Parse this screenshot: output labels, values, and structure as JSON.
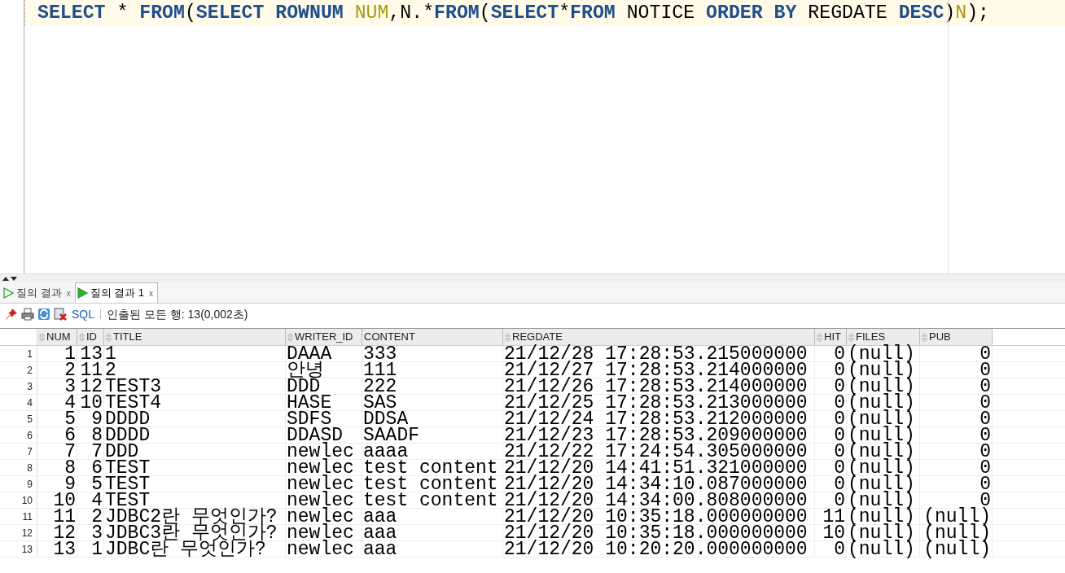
{
  "editor": {
    "tokens": [
      {
        "text": "SELECT",
        "kind": "keyword"
      },
      {
        "text": " * ",
        "kind": "plain"
      },
      {
        "text": "FROM",
        "kind": "keyword"
      },
      {
        "text": "(",
        "kind": "plain"
      },
      {
        "text": "SELECT ROWNUM ",
        "kind": "keyword"
      },
      {
        "text": "NUM",
        "kind": "alias"
      },
      {
        "text": ",N.*",
        "kind": "plain"
      },
      {
        "text": "FROM",
        "kind": "keyword"
      },
      {
        "text": "(",
        "kind": "plain"
      },
      {
        "text": "SELECT",
        "kind": "keyword"
      },
      {
        "text": "*",
        "kind": "plain"
      },
      {
        "text": "FROM",
        "kind": "keyword"
      },
      {
        "text": " NOTICE ",
        "kind": "plain"
      },
      {
        "text": "ORDER BY",
        "kind": "keyword"
      },
      {
        "text": " REGDATE ",
        "kind": "plain"
      },
      {
        "text": "DESC",
        "kind": "keyword"
      },
      {
        "text": ")",
        "kind": "plain"
      },
      {
        "text": "N",
        "kind": "alias"
      },
      {
        "text": ");",
        "kind": "plain"
      }
    ]
  },
  "result_tabs": [
    {
      "label": "질의 결과",
      "close": "x",
      "selected": false
    },
    {
      "label": "질의 결과 1",
      "close": "x",
      "selected": true
    }
  ],
  "toolbar": {
    "sql_link": "SQL",
    "status": "인출된 모든 행: 13(0,002초)"
  },
  "table": {
    "columns": [
      {
        "name": "NUM",
        "kind": "number",
        "sortable": true
      },
      {
        "name": "ID",
        "kind": "number",
        "sortable": true
      },
      {
        "name": "TITLE",
        "kind": "text",
        "sortable": true
      },
      {
        "name": "WRITER_ID",
        "kind": "text",
        "sortable": true
      },
      {
        "name": "CONTENT",
        "kind": "text",
        "sortable": false
      },
      {
        "name": "REGDATE",
        "kind": "text",
        "sortable": true
      },
      {
        "name": "HIT",
        "kind": "number",
        "sortable": true
      },
      {
        "name": "FILES",
        "kind": "text",
        "sortable": true
      },
      {
        "name": "PUB",
        "kind": "number",
        "sortable": true
      }
    ],
    "rows": [
      {
        "number": "1",
        "cells": [
          "1",
          "13",
          "1",
          "DAAA",
          "333",
          "21/12/28 17:28:53.215000000",
          "0",
          "(null)",
          "0"
        ]
      },
      {
        "number": "2",
        "cells": [
          "2",
          "11",
          "2",
          "안녕",
          "111",
          "21/12/27 17:28:53.214000000",
          "0",
          "(null)",
          "0"
        ]
      },
      {
        "number": "3",
        "cells": [
          "3",
          "12",
          "TEST3",
          "DDD",
          "222",
          "21/12/26 17:28:53.214000000",
          "0",
          "(null)",
          "0"
        ]
      },
      {
        "number": "4",
        "cells": [
          "4",
          "10",
          "TEST4",
          "HASE",
          "SAS",
          "21/12/25 17:28:53.213000000",
          "0",
          "(null)",
          "0"
        ]
      },
      {
        "number": "5",
        "cells": [
          "5",
          "9",
          "DDDD",
          "SDFS",
          "DDSA",
          "21/12/24 17:28:53.212000000",
          "0",
          "(null)",
          "0"
        ]
      },
      {
        "number": "6",
        "cells": [
          "6",
          "8",
          "DDDD",
          "DDASD",
          "SAADF",
          "21/12/23 17:28:53.209000000",
          "0",
          "(null)",
          "0"
        ]
      },
      {
        "number": "7",
        "cells": [
          "7",
          "7",
          "DDD",
          "newlec",
          "aaaa",
          "21/12/22 17:24:54.305000000",
          "0",
          "(null)",
          "0"
        ]
      },
      {
        "number": "8",
        "cells": [
          "8",
          "6",
          "TEST",
          "newlec",
          "test content",
          "21/12/20 14:41:51.321000000",
          "0",
          "(null)",
          "0"
        ]
      },
      {
        "number": "9",
        "cells": [
          "9",
          "5",
          "TEST",
          "newlec",
          "test content",
          "21/12/20 14:34:10.087000000",
          "0",
          "(null)",
          "0"
        ]
      },
      {
        "number": "10",
        "cells": [
          "10",
          "4",
          "TEST",
          "newlec",
          "test content",
          "21/12/20 14:34:00.808000000",
          "0",
          "(null)",
          "0"
        ]
      },
      {
        "number": "11",
        "cells": [
          "11",
          "2",
          "JDBC2란 무엇인가?",
          "newlec",
          "aaa",
          "21/12/20 10:35:18.000000000",
          "11",
          "(null)",
          "(null)"
        ]
      },
      {
        "number": "12",
        "cells": [
          "12",
          "3",
          "JDBC3란 무엇인가?",
          "newlec",
          "aaa",
          "21/12/20 10:35:18.000000000",
          "10",
          "(null)",
          "(null)"
        ]
      },
      {
        "number": "13",
        "cells": [
          "13",
          "1",
          "JDBC란 무엇인가?",
          "newlec",
          "aaa",
          "21/12/20 10:20:20.000000000",
          "0",
          "(null)",
          "(null)"
        ]
      }
    ]
  }
}
